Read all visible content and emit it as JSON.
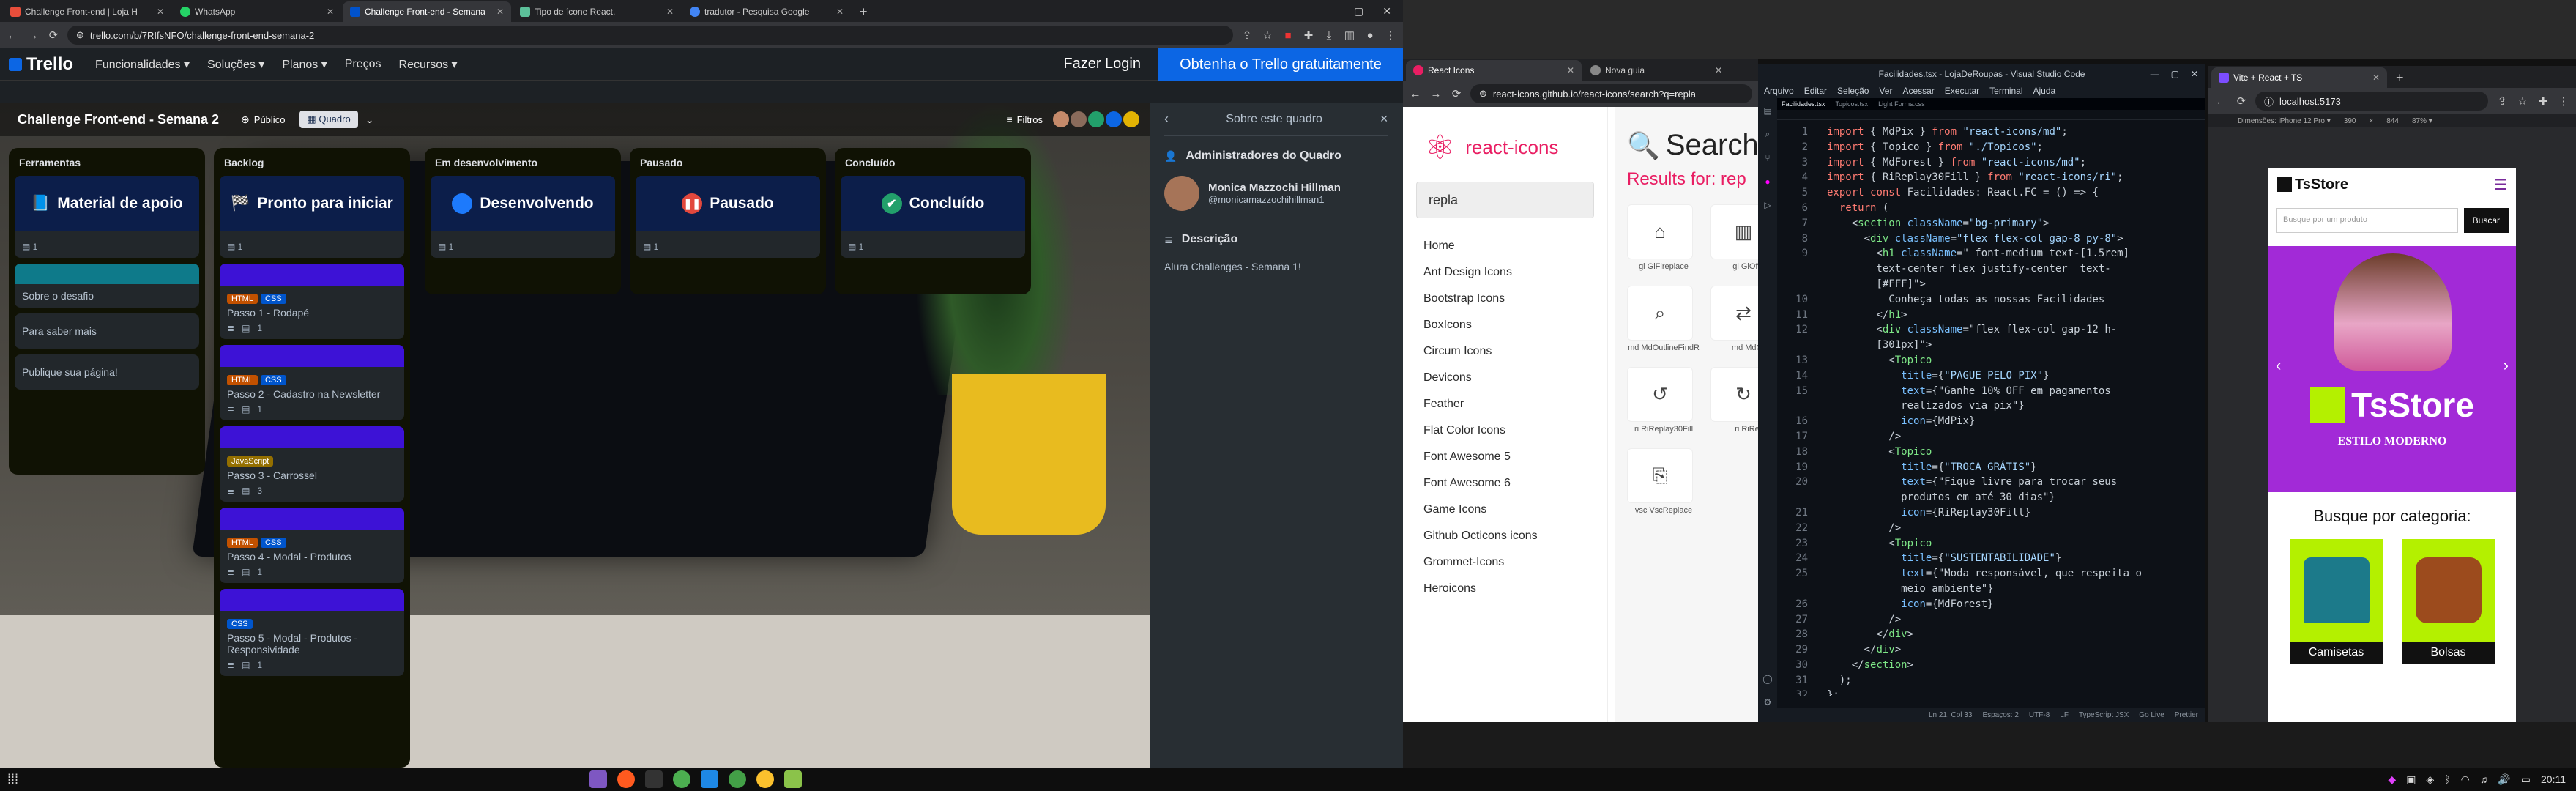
{
  "trello_window": {
    "tabs": [
      {
        "title": "Challenge Front-end | Loja H",
        "color": "#e84e3b"
      },
      {
        "title": "WhatsApp",
        "color": "#25d366"
      },
      {
        "title": "Challenge Front-end - Semana",
        "color": "#0052cc",
        "active": true
      },
      {
        "title": "Tipo de ícone React.",
        "color": "#5cc09a"
      },
      {
        "title": "tradutor - Pesquisa Google",
        "color": "#4285f4"
      }
    ],
    "url": "trello.com/b/7RIfsNFO/challenge-front-end-semana-2",
    "header": {
      "logo": "Trello",
      "nav": [
        "Funcionalidades ▾",
        "Soluções ▾",
        "Planos ▾",
        "Preços",
        "Recursos ▾"
      ],
      "login": "Fazer Login",
      "cta": "Obtenha o Trello gratuitamente"
    },
    "board": {
      "title": "Challenge Front-end - Semana 2",
      "visibility": "Público",
      "view": "Quadro",
      "filters": "Filtros"
    },
    "lists": [
      {
        "title": "Ferramentas",
        "cover_icon": "📘",
        "cover_text": "Material de apoio",
        "cards": [
          "Sobre o desafio",
          "Para saber mais",
          "Publique sua página!"
        ]
      },
      {
        "title": "Backlog",
        "cover_icon": "🏁",
        "cover_text": "Pronto para iniciar",
        "cards": [
          {
            "labels": [
              "HTML",
              "CSS"
            ],
            "title": "Passo 1 - Rodapé",
            "count": "1"
          },
          {
            "labels": [
              "HTML",
              "CSS"
            ],
            "title": "Passo 2 - Cadastro na Newsletter",
            "count": "1"
          },
          {
            "labels": [
              "JavaScript"
            ],
            "title": "Passo 3 - Carrossel",
            "count": "3"
          },
          {
            "labels": [
              "HTML",
              "CSS"
            ],
            "title": "Passo 4 - Modal - Produtos",
            "count": "1"
          },
          {
            "labels": [
              "CSS"
            ],
            "title": "Passo 5 - Modal - Produtos - Responsividade",
            "count": "1"
          }
        ]
      },
      {
        "title": "Em desenvolvimento",
        "cover_text": "Desenvolvendo"
      },
      {
        "title": "Pausado",
        "cover_text": "Pausado"
      },
      {
        "title": "Concluído",
        "cover_text": "Concluído"
      }
    ],
    "panel": {
      "title": "Sobre este quadro",
      "admins_heading": "Administradores do Quadro",
      "admin_name": "Monica Mazzochi Hillman",
      "admin_handle": "@monicamazzochihillman1",
      "desc_heading": "Descrição",
      "desc": "Alura Challenges - Semana 1!"
    }
  },
  "react_icons_window": {
    "tabs": [
      "React Icons",
      "Nova guia"
    ],
    "url": "react-icons.github.io/react-icons/search?q=repla",
    "logo": "react-icons",
    "search_value": "repla",
    "sidebar": [
      "Home",
      "Ant Design Icons",
      "Bootstrap Icons",
      "BoxIcons",
      "Circum Icons",
      "Devicons",
      "Feather",
      "Flat Color Icons",
      "Font Awesome 5",
      "Font Awesome 6",
      "Game Icons",
      "Github Octicons icons",
      "Grommet-Icons",
      "Heroicons"
    ],
    "heading": "Search",
    "results_label": "Results for: rep",
    "icons": [
      "gi GiFireplace",
      "gi GiOffi",
      "md MdOutlineFindR",
      "md MdO",
      "ri RiReplay30Fill",
      "ri RiRe",
      "vsc VscReplace"
    ]
  },
  "vscode_window": {
    "title": "Facilidades.tsx - LojaDeRoupas - Visual Studio Code",
    "menu": [
      "Arquivo",
      "Editar",
      "Seleção",
      "Ver",
      "Acessar",
      "Executar",
      "Terminal",
      "Ajuda"
    ],
    "tabs": [
      "Facilidades.tsx",
      "Topicos.tsx",
      "Light Forms.css"
    ],
    "status": [
      "Ln 21, Col 33",
      "Espaços: 2",
      "UTF-8",
      "LF",
      "TypeScript JSX",
      "Go Live",
      "Prettier"
    ],
    "lines": [
      [
        "1",
        "import { MdPix } from \"react-icons/md\";"
      ],
      [
        "2",
        "import { Topico } from \"./Topicos\";"
      ],
      [
        "3",
        "import { MdForest } from \"react-icons/md\";"
      ],
      [
        "4",
        "import { RiReplay30Fill } from \"react-icons/ri\";"
      ],
      [
        "5",
        "export const Facilidades: React.FC = () => {"
      ],
      [
        "6",
        "  return ("
      ],
      [
        "7",
        "    <section className=\"bg-primary\">"
      ],
      [
        "8",
        "      <div className=\"flex flex-col gap-8 py-8\">"
      ],
      [
        "9",
        "        <h1 className=\" font-medium text-[1.5rem]"
      ],
      [
        "",
        "        text-center flex justify-center  text-"
      ],
      [
        "",
        "        [#FFF]\">"
      ],
      [
        "10",
        "          Conheça todas as nossas Facilidades"
      ],
      [
        "11",
        "        </h1>"
      ],
      [
        "12",
        "        <div className=\"flex flex-col gap-12 h-"
      ],
      [
        "",
        "        [301px]\">"
      ],
      [
        "13",
        "          <Topico"
      ],
      [
        "14",
        "            title={\"PAGUE PELO PIX\"}"
      ],
      [
        "15",
        "            text={\"Ganhe 10% OFF em pagamentos"
      ],
      [
        "",
        "            realizados via pix\"}"
      ],
      [
        "16",
        "            icon={MdPix}"
      ],
      [
        "17",
        "          />"
      ],
      [
        "18",
        "          <Topico"
      ],
      [
        "19",
        "            title={\"TROCA GRÁTIS\"}"
      ],
      [
        "20",
        "            text={\"Fique livre para trocar seus"
      ],
      [
        "",
        "            produtos em até 30 dias\"}"
      ],
      [
        "21",
        "            icon={RiReplay30Fill}"
      ],
      [
        "22",
        "          />"
      ],
      [
        "23",
        "          <Topico"
      ],
      [
        "24",
        "            title={\"SUSTENTABILIDADE\"}"
      ],
      [
        "25",
        "            text={\"Moda responsável, que respeita o"
      ],
      [
        "",
        "            meio ambiente\"}"
      ],
      [
        "26",
        "            icon={MdForest}"
      ],
      [
        "27",
        "          />"
      ],
      [
        "28",
        "        </div>"
      ],
      [
        "29",
        "      </div>"
      ],
      [
        "30",
        "    </section>"
      ],
      [
        "31",
        "  );"
      ],
      [
        "32",
        "};"
      ]
    ]
  },
  "vite_window": {
    "tab": "Vite + React + TS",
    "url": "localhost:5173",
    "device": "Dimensões: iPhone 12 Pro ▾",
    "width": "390",
    "height": "844",
    "zoom": "87% ▾",
    "brand": "TsStore",
    "search_placeholder": "Busque por um produto",
    "search_btn": "Buscar",
    "banner_brand": "TsStore",
    "banner_tag": "ESTILO MODERNO",
    "category_heading": "Busque por categoria:",
    "categories": [
      "Camisetas",
      "Bolsas"
    ]
  },
  "taskbar": {
    "clock": "20:11"
  },
  "colors": {
    "trello_blue": "#0c66e4",
    "react_red": "#e91e63",
    "vscode_bg": "#0d1117",
    "vite_purple": "#a22ad7",
    "lime": "#b4f000"
  }
}
